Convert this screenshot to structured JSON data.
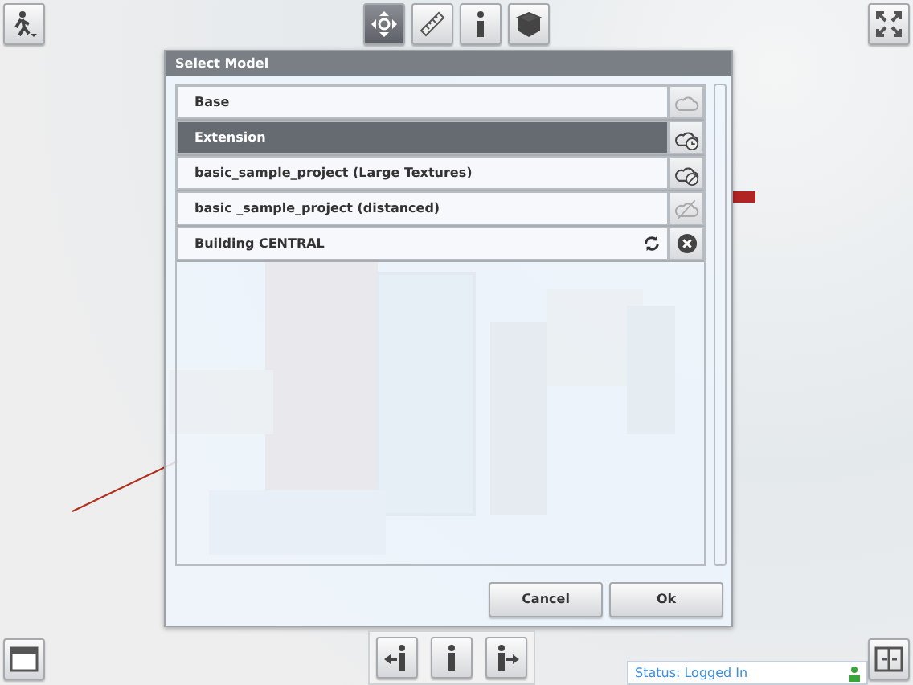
{
  "top_toolbar": {
    "tools": [
      {
        "kind": "move",
        "selected": true
      },
      {
        "kind": "ruler",
        "selected": false
      },
      {
        "kind": "info",
        "selected": false
      },
      {
        "kind": "cube",
        "selected": false
      }
    ]
  },
  "dialog": {
    "title": "Select Model",
    "models": [
      {
        "label": "Base",
        "selected": false,
        "kind": "cloud"
      },
      {
        "label": "Extension",
        "selected": true,
        "kind": "cloud-clock"
      },
      {
        "label": "basic_sample_project (Large Textures)",
        "selected": false,
        "kind": "cloud-blocked"
      },
      {
        "label": "basic _sample_project (distanced)",
        "selected": false,
        "kind": "cloud-off"
      },
      {
        "label": "Building CENTRAL",
        "selected": false,
        "kind": "local"
      }
    ],
    "buttons": [
      "Cancel",
      "Ok"
    ]
  },
  "status": {
    "label": "Status:",
    "value": "Logged In"
  }
}
